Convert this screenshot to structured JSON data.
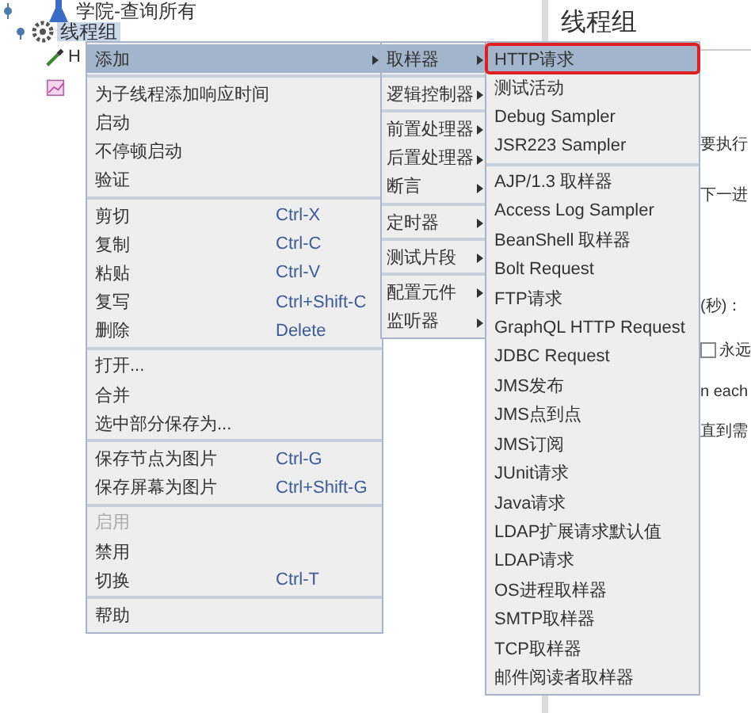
{
  "tree": [
    {
      "label": "学院-查询所有",
      "kind": "plan",
      "selected": false,
      "children": [
        {
          "label": "线程组",
          "kind": "group",
          "selected": true,
          "children": [
            {
              "label": "H",
              "kind": "sampler"
            },
            {
              "kind": "listener"
            }
          ]
        }
      ]
    }
  ],
  "panel": {
    "title": "线程组",
    "fragments": [
      {
        "kind": "text",
        "text": "要执行"
      },
      {
        "kind": "text",
        "text": "下一进"
      },
      {
        "kind": "text",
        "text": "(秒)："
      },
      {
        "kind": "checkbox",
        "text": "永远",
        "checked": false
      },
      {
        "kind": "text",
        "text": "n each"
      },
      {
        "kind": "text",
        "text": "直到需"
      }
    ]
  },
  "context_menu": [
    {
      "kind": "item",
      "label": "添加",
      "submenu": true,
      "selected": true,
      "disabled": false
    },
    {
      "kind": "separator"
    },
    {
      "kind": "item",
      "label": "为子线程添加响应时间",
      "selected": false,
      "disabled": false
    },
    {
      "kind": "item",
      "label": "启动",
      "selected": false,
      "disabled": false
    },
    {
      "kind": "item",
      "label": "不停顿启动",
      "selected": false,
      "disabled": false
    },
    {
      "kind": "item",
      "label": "验证",
      "selected": false,
      "disabled": false
    },
    {
      "kind": "separator"
    },
    {
      "kind": "item",
      "label": "剪切",
      "shortcut": "Ctrl-X",
      "selected": false,
      "disabled": false
    },
    {
      "kind": "item",
      "label": "复制",
      "shortcut": "Ctrl-C",
      "selected": false,
      "disabled": false
    },
    {
      "kind": "item",
      "label": "粘贴",
      "shortcut": "Ctrl-V",
      "selected": false,
      "disabled": false
    },
    {
      "kind": "item",
      "label": "复写",
      "shortcut": "Ctrl+Shift-C",
      "selected": false,
      "disabled": false
    },
    {
      "kind": "item",
      "label": "删除",
      "shortcut": "Delete",
      "selected": false,
      "disabled": false
    },
    {
      "kind": "separator"
    },
    {
      "kind": "item",
      "label": "打开...",
      "selected": false,
      "disabled": false
    },
    {
      "kind": "item",
      "label": "合并",
      "selected": false,
      "disabled": false
    },
    {
      "kind": "item",
      "label": "选中部分保存为...",
      "selected": false,
      "disabled": false
    },
    {
      "kind": "separator"
    },
    {
      "kind": "item",
      "label": "保存节点为图片",
      "shortcut": "Ctrl-G",
      "selected": false,
      "disabled": false
    },
    {
      "kind": "item",
      "label": "保存屏幕为图片",
      "shortcut": "Ctrl+Shift-G",
      "selected": false,
      "disabled": false
    },
    {
      "kind": "separator"
    },
    {
      "kind": "item",
      "label": "启用",
      "selected": false,
      "disabled": true
    },
    {
      "kind": "item",
      "label": "禁用",
      "selected": false,
      "disabled": false
    },
    {
      "kind": "item",
      "label": "切换",
      "shortcut": "Ctrl-T",
      "selected": false,
      "disabled": false
    },
    {
      "kind": "separator"
    },
    {
      "kind": "item",
      "label": "帮助",
      "selected": false,
      "disabled": false
    }
  ],
  "add_menu": [
    {
      "kind": "item",
      "label": "取样器",
      "submenu": true,
      "selected": true
    },
    {
      "kind": "separator"
    },
    {
      "kind": "item",
      "label": "逻辑控制器",
      "submenu": true,
      "selected": false
    },
    {
      "kind": "separator"
    },
    {
      "kind": "item",
      "label": "前置处理器",
      "submenu": true,
      "selected": false
    },
    {
      "kind": "item",
      "label": "后置处理器",
      "submenu": true,
      "selected": false
    },
    {
      "kind": "item",
      "label": "断言",
      "submenu": true,
      "selected": false
    },
    {
      "kind": "separator"
    },
    {
      "kind": "item",
      "label": "定时器",
      "submenu": true,
      "selected": false
    },
    {
      "kind": "separator"
    },
    {
      "kind": "item",
      "label": "测试片段",
      "submenu": true,
      "selected": false
    },
    {
      "kind": "separator"
    },
    {
      "kind": "item",
      "label": "配置元件",
      "submenu": true,
      "selected": false
    },
    {
      "kind": "item",
      "label": "监听器",
      "submenu": true,
      "selected": false
    }
  ],
  "sampler_menu": [
    {
      "kind": "item",
      "label": "HTTP请求",
      "selected": true,
      "annotated": true
    },
    {
      "kind": "item",
      "label": "测试活动",
      "selected": false,
      "annotated": false
    },
    {
      "kind": "item",
      "label": "Debug Sampler",
      "selected": false,
      "annotated": false
    },
    {
      "kind": "item",
      "label": "JSR223 Sampler",
      "selected": false,
      "annotated": false
    },
    {
      "kind": "separator"
    },
    {
      "kind": "item",
      "label": "AJP/1.3 取样器",
      "selected": false,
      "annotated": false
    },
    {
      "kind": "item",
      "label": "Access Log Sampler",
      "selected": false,
      "annotated": false
    },
    {
      "kind": "item",
      "label": "BeanShell 取样器",
      "selected": false,
      "annotated": false
    },
    {
      "kind": "item",
      "label": "Bolt Request",
      "selected": false,
      "annotated": false
    },
    {
      "kind": "item",
      "label": "FTP请求",
      "selected": false,
      "annotated": false
    },
    {
      "kind": "item",
      "label": "GraphQL HTTP Request",
      "selected": false,
      "annotated": false
    },
    {
      "kind": "item",
      "label": "JDBC Request",
      "selected": false,
      "annotated": false
    },
    {
      "kind": "item",
      "label": "JMS发布",
      "selected": false,
      "annotated": false
    },
    {
      "kind": "item",
      "label": "JMS点到点",
      "selected": false,
      "annotated": false
    },
    {
      "kind": "item",
      "label": "JMS订阅",
      "selected": false,
      "annotated": false
    },
    {
      "kind": "item",
      "label": "JUnit请求",
      "selected": false,
      "annotated": false
    },
    {
      "kind": "item",
      "label": "Java请求",
      "selected": false,
      "annotated": false
    },
    {
      "kind": "item",
      "label": "LDAP扩展请求默认值",
      "selected": false,
      "annotated": false
    },
    {
      "kind": "item",
      "label": "LDAP请求",
      "selected": false,
      "annotated": false
    },
    {
      "kind": "item",
      "label": "OS进程取样器",
      "selected": false,
      "annotated": false
    },
    {
      "kind": "item",
      "label": "SMTP取样器",
      "selected": false,
      "annotated": false
    },
    {
      "kind": "item",
      "label": "TCP取样器",
      "selected": false,
      "annotated": false
    },
    {
      "kind": "item",
      "label": "邮件阅读者取样器",
      "selected": false,
      "annotated": false
    }
  ]
}
